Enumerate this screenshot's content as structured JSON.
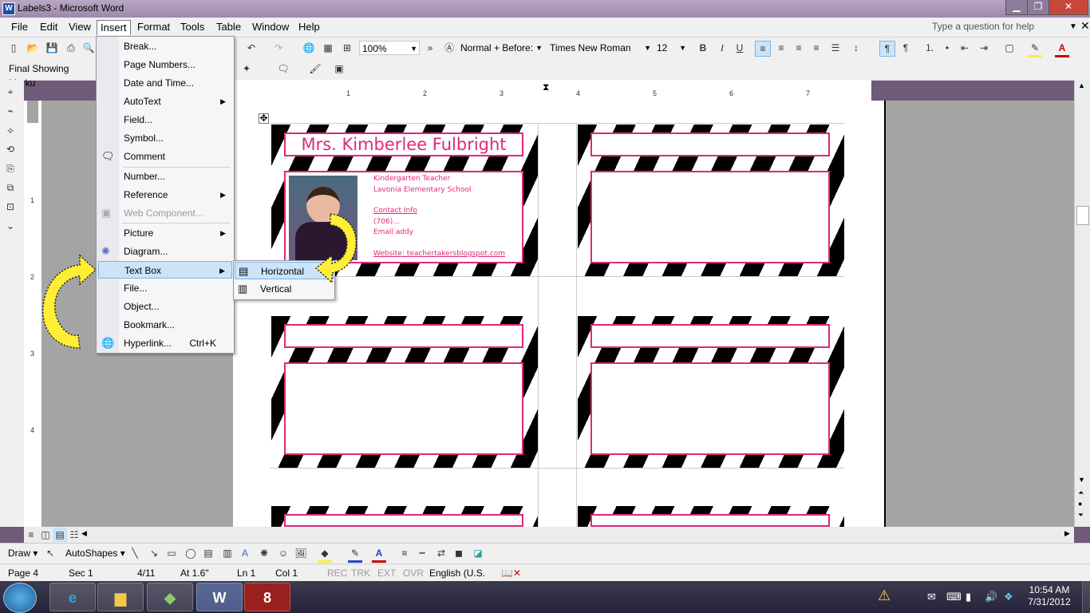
{
  "window": {
    "title": "Labels3 - Microsoft Word",
    "app_icon": "W"
  },
  "menubar": {
    "items": [
      "File",
      "Edit",
      "View",
      "Insert",
      "Format",
      "Tools",
      "Table",
      "Window",
      "Help"
    ],
    "active": "Insert",
    "ask_placeholder": "Type a question for help"
  },
  "toolbar_format": {
    "zoom": "100%",
    "style": "Normal + Before:",
    "font": "Times New Roman",
    "size": "12",
    "bold": "B",
    "italic": "I",
    "underline": "U"
  },
  "toolbar_review": {
    "markup_combo": "Final Showing Marku"
  },
  "ruler": {
    "numbers": [
      "1",
      "2",
      "3",
      "4",
      "5",
      "6",
      "7"
    ]
  },
  "vruler": {
    "numbers": [
      "1",
      "2",
      "3",
      "4"
    ]
  },
  "insert_menu": {
    "items": [
      {
        "label": "Break...",
        "submenu": false
      },
      {
        "label": "Page Numbers...",
        "submenu": false
      },
      {
        "label": "Date and Time...",
        "submenu": false
      },
      {
        "label": "AutoText",
        "submenu": true
      },
      {
        "label": "Field...",
        "submenu": false
      },
      {
        "label": "Symbol...",
        "submenu": false
      },
      {
        "label": "Comment",
        "submenu": false,
        "icon": "comment-icon"
      },
      {
        "label": "Number...",
        "submenu": false
      },
      {
        "label": "Reference",
        "submenu": true
      },
      {
        "label": "Web Component...",
        "submenu": false,
        "disabled": true,
        "icon": "web-component-icon"
      },
      {
        "label": "Picture",
        "submenu": true
      },
      {
        "label": "Diagram...",
        "submenu": false,
        "icon": "diagram-icon"
      },
      {
        "label": "Text Box",
        "submenu": true,
        "highlighted": true
      },
      {
        "label": "File...",
        "submenu": false
      },
      {
        "label": "Object...",
        "submenu": false
      },
      {
        "label": "Bookmark...",
        "submenu": false
      },
      {
        "label": "Hyperlink...",
        "submenu": false,
        "shortcut": "Ctrl+K",
        "icon": "hyperlink-icon"
      }
    ]
  },
  "textbox_submenu": {
    "items": [
      "Horizontal",
      "Vertical"
    ],
    "highlighted": "Horizontal"
  },
  "card1": {
    "name": "Mrs. Kimberlee Fulbright",
    "lines": [
      "Kindergarten Teacher",
      "Lavonia Elementary School",
      "",
      "Contact Info",
      "(706)...",
      "Email addy",
      "",
      "Website: teachertakersblogspot.com"
    ]
  },
  "drawbar": {
    "draw": "Draw",
    "autoshapes": "AutoShapes"
  },
  "status": {
    "page": "Page 4",
    "sec": "Sec 1",
    "of": "4/11",
    "at": "At 1.6\"",
    "ln": "Ln 1",
    "col": "Col 1",
    "rec": "REC",
    "trk": "TRK",
    "ext": "EXT",
    "ovr": "OVR",
    "lang": "English (U.S."
  },
  "taskbar": {
    "time": "10:54 AM",
    "date": "7/31/2012",
    "psp_badge": "8"
  },
  "colors": {
    "accent_pink": "#e0287a",
    "highlight": "#cce4f7",
    "arrow_yellow": "#ffee33"
  }
}
